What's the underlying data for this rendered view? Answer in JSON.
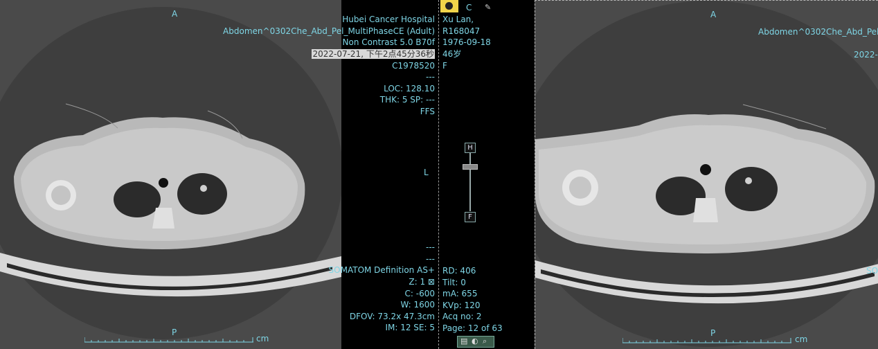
{
  "colors": {
    "overlay_text": "#7fd6e6",
    "viewport_bg": "#4a4a4a",
    "highlight_bg": "#d9d9d9"
  },
  "left_viewport": {
    "orient_top": "A",
    "orient_bottom": "P",
    "orient_right": "L",
    "ruler_unit": "cm",
    "top_right": [
      "Hubei Cancer Hospital",
      "Abdomen^0302Che_Abd_Pel_MultiPhaseCE (Adult)",
      "Non Contrast 5.0 B70f",
      "2022-07-21, 下午2点45分36秒",
      "C1978520",
      "---",
      "LOC: 128.10",
      "THK: 5 SP: ---",
      "FFS"
    ],
    "bottom_right": [
      "---",
      "---",
      "SOMATOM Definition AS+",
      "Z: 1 ⊠",
      "C: -600",
      "W: 1600",
      "DFOV: 73.2x 47.3cm",
      "IM: 12 SE: 5"
    ]
  },
  "middle_panel": {
    "top_letter": "C",
    "top_left": [
      "Xu Lan,",
      "R168047",
      "1976-09-18",
      "46岁",
      "F"
    ],
    "bottom_left": [
      "RD: 406",
      "Tilt: 0",
      "mA: 655",
      "KVp: 120",
      "Acq no: 2",
      "Page: 12 of 63"
    ],
    "slider_top": "H",
    "slider_bottom": "F"
  },
  "right_viewport": {
    "orient_top": "A",
    "orient_bottom": "P",
    "ruler_unit": "cm",
    "top_right": [
      "Abdomen^0302Che_Abd_Pel",
      "2022-"
    ],
    "bottom_right": [
      "SO"
    ]
  }
}
